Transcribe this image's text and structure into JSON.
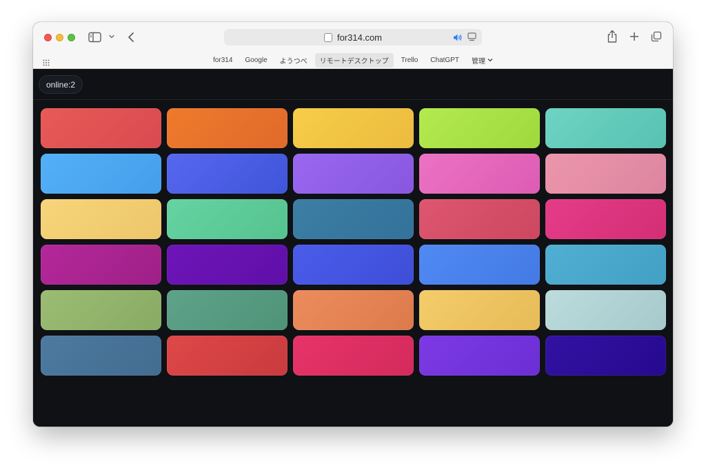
{
  "browser": {
    "url": "for314.com",
    "favorites": [
      {
        "label": "for314",
        "active": false
      },
      {
        "label": "Google",
        "active": false
      },
      {
        "label": "ようつべ",
        "active": false
      },
      {
        "label": "リモートデスクトップ",
        "active": true
      },
      {
        "label": "Trello",
        "active": false
      },
      {
        "label": "ChatGPT",
        "active": false
      },
      {
        "label": "管理",
        "active": false,
        "dropdown": true
      }
    ]
  },
  "page": {
    "online_label": "online:2",
    "tiles": [
      {
        "from": "#e85a57",
        "to": "#d84a50"
      },
      {
        "from": "#ee7a2c",
        "to": "#e06a2a"
      },
      {
        "from": "#f6cd48",
        "to": "#ecbb3f"
      },
      {
        "from": "#b3ea4f",
        "to": "#9ed93c"
      },
      {
        "from": "#6ed3c3",
        "to": "#58c2b1"
      },
      {
        "from": "#54b0f8",
        "to": "#459ee9"
      },
      {
        "from": "#5667f0",
        "to": "#3f55d9"
      },
      {
        "from": "#9a68f0",
        "to": "#8857e0"
      },
      {
        "from": "#ec72c4",
        "to": "#dc5cb3"
      },
      {
        "from": "#ec96ac",
        "to": "#dd85a0"
      },
      {
        "from": "#f8d57a",
        "to": "#ecc66b"
      },
      {
        "from": "#66d4a2",
        "to": "#55c28f"
      },
      {
        "from": "#3c7ea4",
        "to": "#33729a"
      },
      {
        "from": "#de5670",
        "to": "#cc4760"
      },
      {
        "from": "#e53c87",
        "to": "#d32e76"
      },
      {
        "from": "#b4289a",
        "to": "#9e2087"
      },
      {
        "from": "#6e15b8",
        "to": "#5f0fa8"
      },
      {
        "from": "#4a5cea",
        "to": "#3e4ed8"
      },
      {
        "from": "#5189f4",
        "to": "#437ae4"
      },
      {
        "from": "#50afd2",
        "to": "#41a0c4"
      },
      {
        "from": "#9bbc72",
        "to": "#88ab65"
      },
      {
        "from": "#5ea28a",
        "to": "#4f9379"
      },
      {
        "from": "#ec8c5c",
        "to": "#dc7a4c"
      },
      {
        "from": "#f4cc6a",
        "to": "#e6bb58"
      },
      {
        "from": "#bcdcdd",
        "to": "#a6c9cb"
      },
      {
        "from": "#4e7aa0",
        "to": "#426c90"
      },
      {
        "from": "#de4848",
        "to": "#c93b3f"
      },
      {
        "from": "#e73468",
        "to": "#d32a5c"
      },
      {
        "from": "#7d3ae4",
        "to": "#6b2ed4"
      },
      {
        "from": "#3212a2",
        "to": "#27098f"
      }
    ]
  }
}
